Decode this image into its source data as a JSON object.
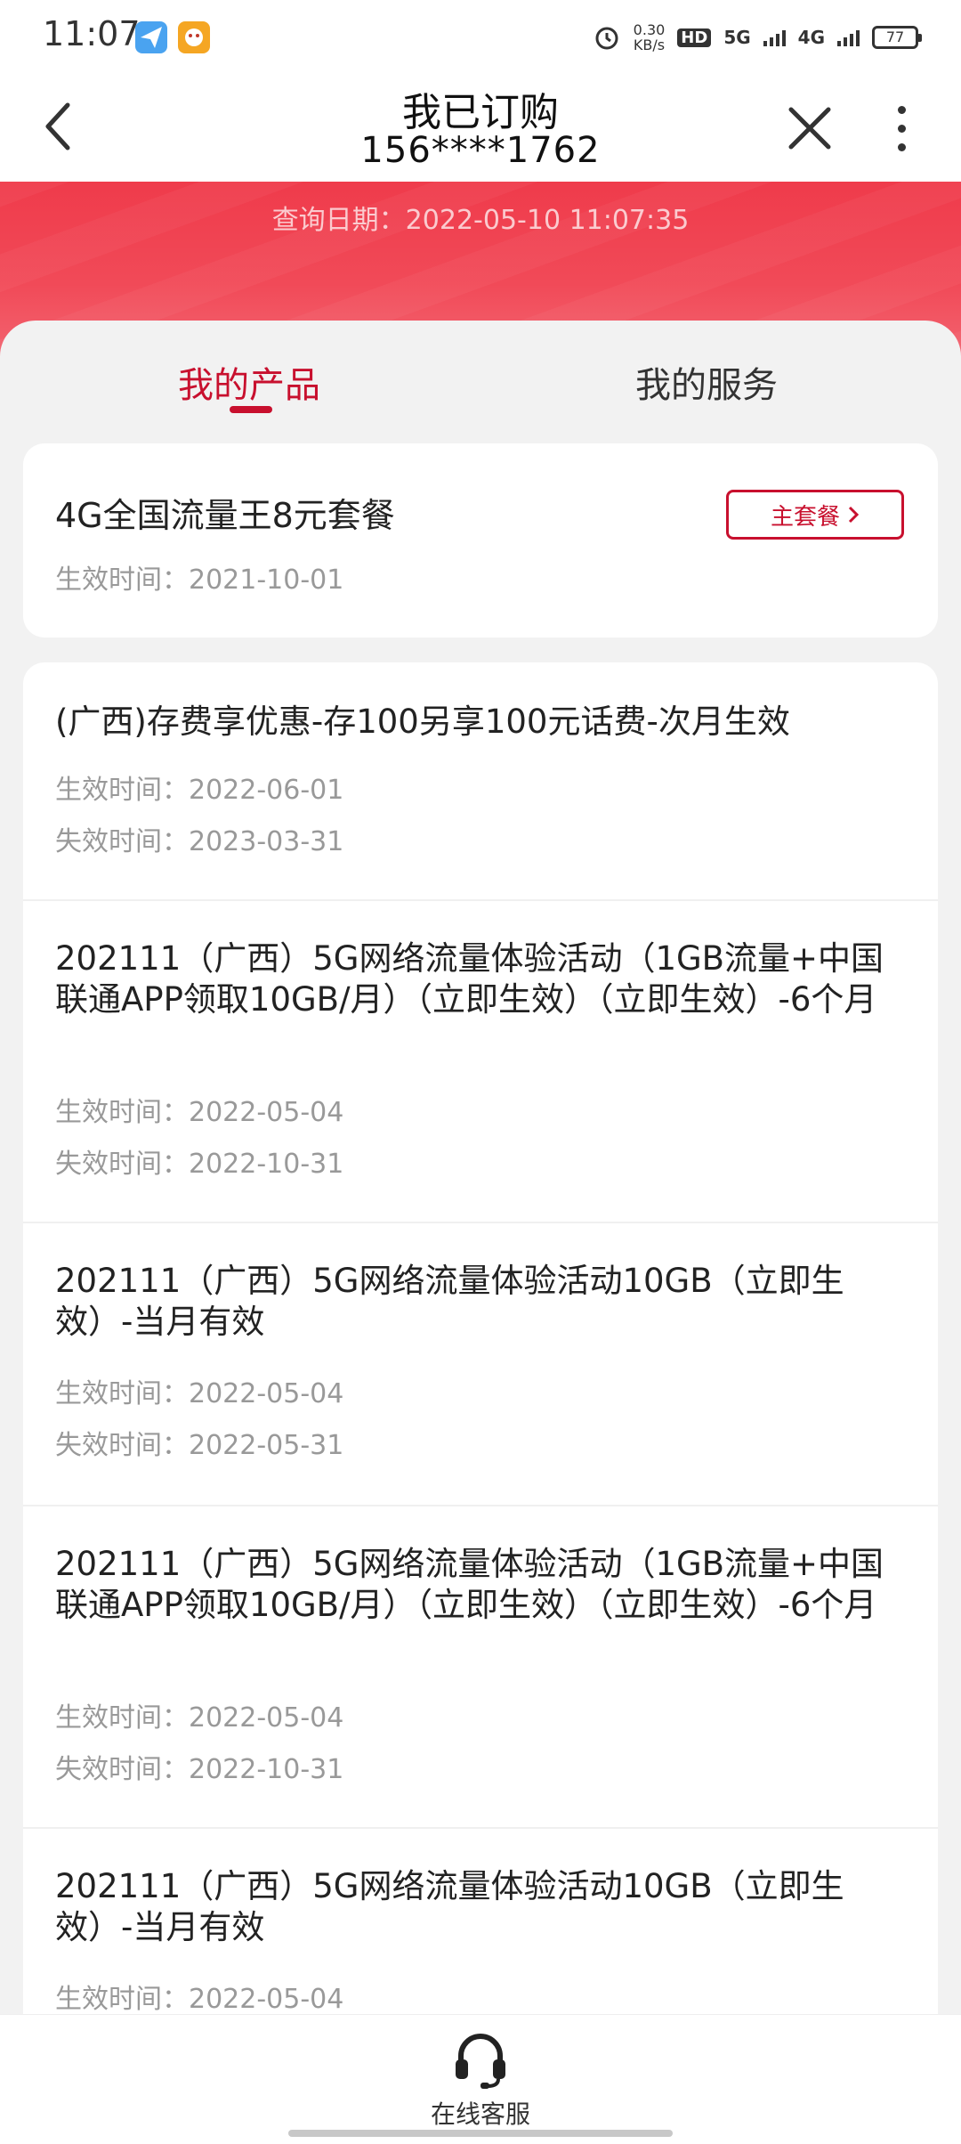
{
  "status_bar": {
    "time": "11:07",
    "net_speed_value": "0.30",
    "net_speed_unit": "KB/s",
    "hd_label": "HD",
    "sim1_label": "5G",
    "sim2_label": "4G",
    "battery": "77"
  },
  "header": {
    "title": "我已订购",
    "phone": "156****1762"
  },
  "banner": {
    "query_date": "查询日期：2022-05-10 11:07:35"
  },
  "tabs": [
    {
      "label": "我的产品",
      "active": true
    },
    {
      "label": "我的服务",
      "active": false
    }
  ],
  "main_package": {
    "name": "4G全国流量王8元套餐",
    "badge": "主套餐",
    "start": "生效时间：2021-10-01"
  },
  "products": [
    {
      "name": "(广西)存费享优惠-存100另享100元话费-次月生效",
      "start": "生效时间：2022-06-01",
      "end": "失效时间：2023-03-31"
    },
    {
      "name": "202111（广西）5G网络流量体验活动（1GB流量+中国联通APP领取10GB/月）（立即生效）（立即生效）-6个月",
      "start": "生效时间：2022-05-04",
      "end": "失效时间：2022-10-31"
    },
    {
      "name": "202111（广西）5G网络流量体验活动10GB（立即生效）-当月有效",
      "start": "生效时间：2022-05-04",
      "end": "失效时间：2022-05-31"
    },
    {
      "name": "202111（广西）5G网络流量体验活动（1GB流量+中国联通APP领取10GB/月）（立即生效）（立即生效）-6个月",
      "start": "生效时间：2022-05-04",
      "end": "失效时间：2022-10-31"
    },
    {
      "name": "202111（广西）5G网络流量体验活动10GB（立即生效）-当月有效",
      "start": "生效时间：2022-05-04",
      "end": ""
    }
  ],
  "bottom": {
    "service_label": "在线客服"
  },
  "colors": {
    "accent": "#c8102e",
    "banner": "#ef3b4b"
  }
}
